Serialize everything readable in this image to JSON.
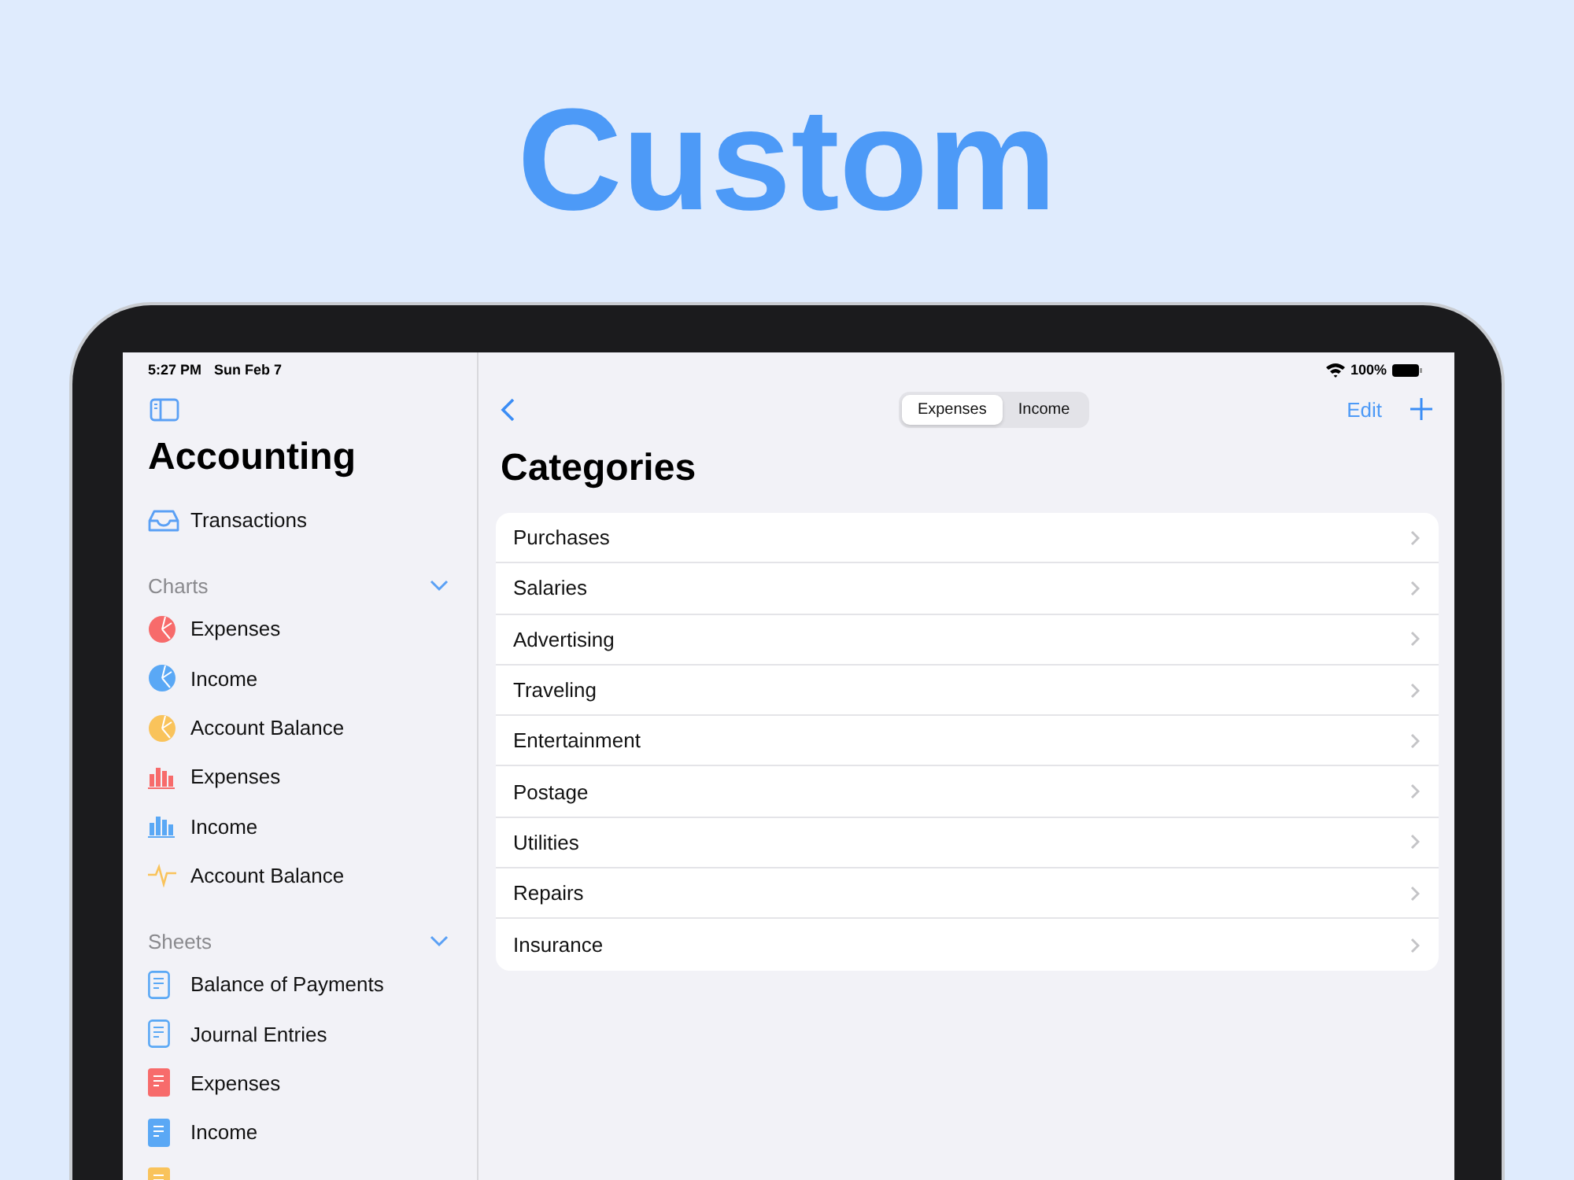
{
  "headline": "Custom",
  "status_bar": {
    "time": "5:27 PM",
    "date": "Sun Feb 7",
    "battery": "100%"
  },
  "sidebar": {
    "title": "Accounting",
    "top_items": [
      {
        "label": "Transactions",
        "kind": "tray",
        "color": "#5aa0f5"
      }
    ],
    "sections": [
      {
        "title": "Charts",
        "expanded": true,
        "items": [
          {
            "label": "Expenses",
            "kind": "pie",
            "color": "#f76b6b"
          },
          {
            "label": "Income",
            "kind": "pie",
            "color": "#5aa8f5"
          },
          {
            "label": "Account Balance",
            "kind": "pie",
            "color": "#f9c35b"
          },
          {
            "label": "Expenses",
            "kind": "bars",
            "color": "#f76b6b"
          },
          {
            "label": "Income",
            "kind": "bars",
            "color": "#5aa8f5"
          },
          {
            "label": "Account Balance",
            "kind": "pulse",
            "color": "#f9c35b"
          }
        ]
      },
      {
        "title": "Sheets",
        "expanded": true,
        "items": [
          {
            "label": "Balance of Payments",
            "kind": "sheet",
            "color": "#5aa8f5"
          },
          {
            "label": "Journal Entries",
            "kind": "sheet",
            "color": "#5aa8f5"
          },
          {
            "label": "Expenses",
            "kind": "sheet-filled",
            "color": "#f76b6b"
          },
          {
            "label": "Income",
            "kind": "sheet-filled",
            "color": "#5aa8f5"
          },
          {
            "kind": "sheet-filled",
            "color": "#f9c35b"
          }
        ]
      }
    ]
  },
  "toolbar": {
    "segments": [
      {
        "label": "Expenses",
        "selected": true
      },
      {
        "label": "Income",
        "selected": false
      }
    ],
    "edit": "Edit"
  },
  "main": {
    "title": "Categories",
    "rows": [
      "Purchases",
      "Salaries",
      "Advertising",
      "Traveling",
      "Entertainment",
      "Postage",
      "Utilities",
      "Repairs",
      "Insurance"
    ]
  }
}
